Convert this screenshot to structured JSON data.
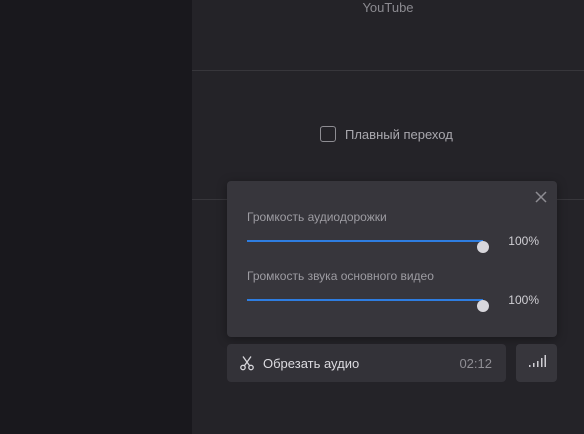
{
  "sources": {
    "youtube_label": "YouTube"
  },
  "transition": {
    "smooth_label": "Плавный переход",
    "checked": false
  },
  "volume_popup": {
    "track_volume": {
      "label": "Громкость аудиодорожки",
      "value": 1.0,
      "value_text": "100%"
    },
    "video_volume": {
      "label": "Громкость звука основного видео",
      "value": 1.0,
      "value_text": "100%"
    },
    "accent_color": "#2e7de0"
  },
  "audio": {
    "trim_label": "Обрезать аудио",
    "duration": "02:12"
  },
  "icons": {
    "close": "close-icon",
    "scissors": "scissors-icon",
    "volume": "volume-bars-icon"
  }
}
